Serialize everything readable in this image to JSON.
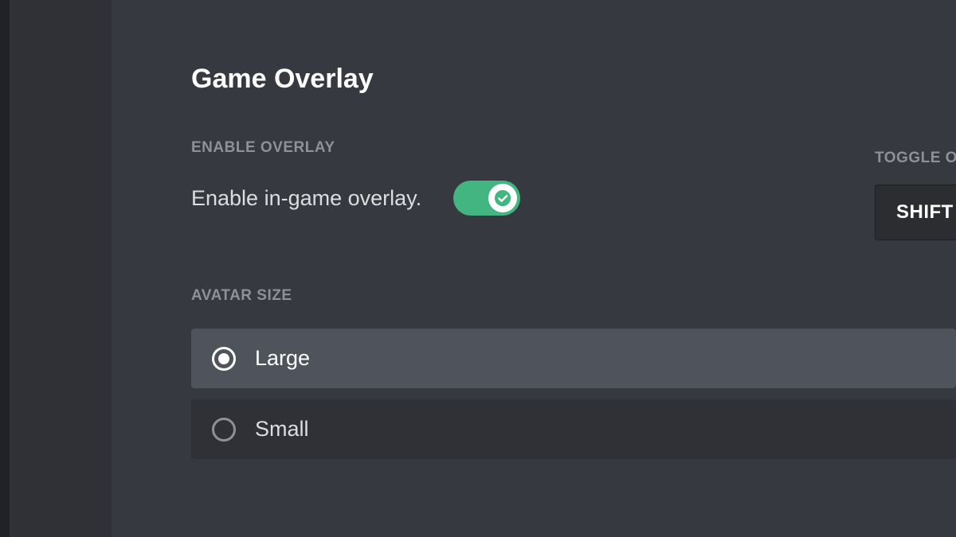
{
  "page": {
    "title": "Game Overlay"
  },
  "enable_overlay": {
    "label": "ENABLE OVERLAY",
    "description": "Enable in-game overlay.",
    "enabled": true
  },
  "toggle_lock": {
    "label": "TOGGLE OVERLAY LOCK",
    "keybind": "SHIFT + `"
  },
  "avatar_size": {
    "label": "AVATAR SIZE",
    "options": [
      {
        "label": "Large",
        "selected": true
      },
      {
        "label": "Small",
        "selected": false
      }
    ]
  },
  "colors": {
    "toggle_on": "#43b581",
    "bg_main": "#36393f",
    "bg_sidebar": "#2f3136"
  }
}
